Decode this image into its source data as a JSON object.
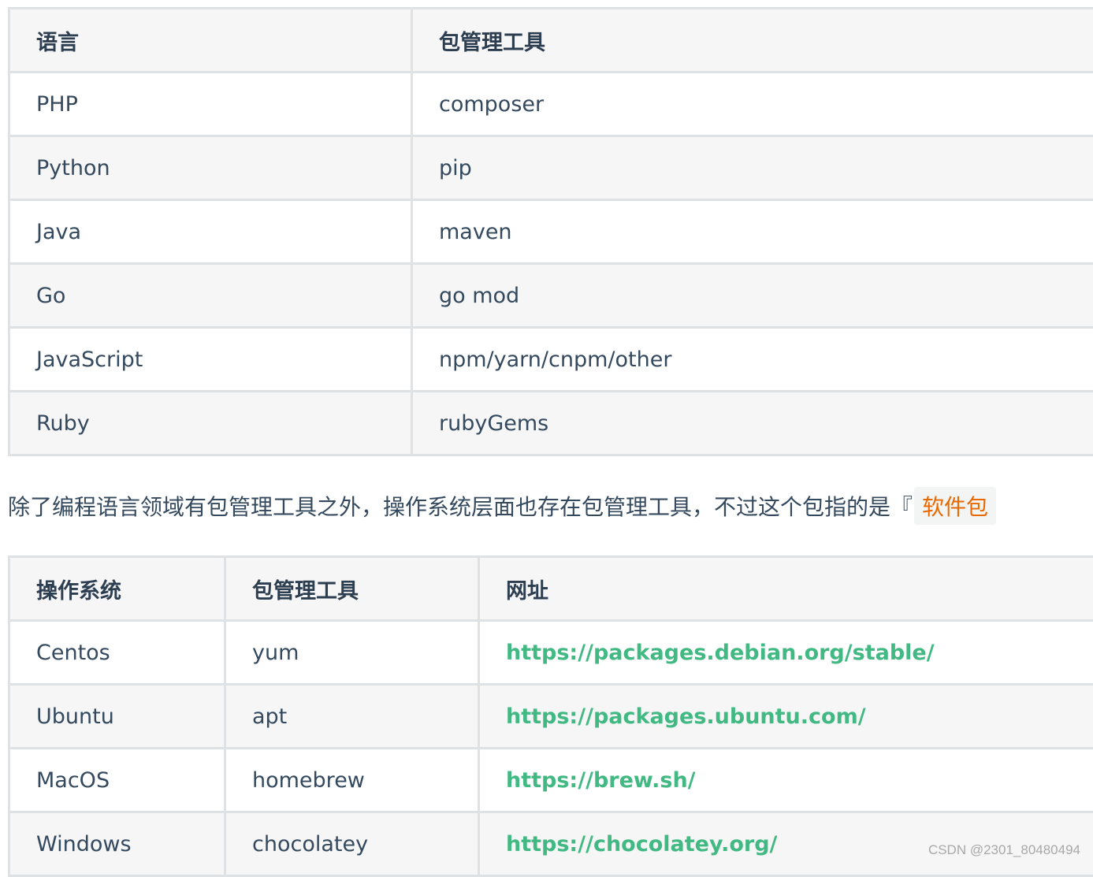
{
  "lang_table": {
    "headers": [
      "语言",
      "包管理工具"
    ],
    "rows": [
      [
        "PHP",
        "composer"
      ],
      [
        "Python",
        "pip"
      ],
      [
        "Java",
        "maven"
      ],
      [
        "Go",
        "go mod"
      ],
      [
        "JavaScript",
        "npm/yarn/cnpm/other"
      ],
      [
        "Ruby",
        "rubyGems"
      ]
    ]
  },
  "paragraph": {
    "text": "除了编程语言领域有包管理工具之外，操作系统层面也存在包管理工具，不过这个包指的是『",
    "code": "软件包"
  },
  "os_table": {
    "headers": [
      "操作系统",
      "包管理工具",
      "网址"
    ],
    "rows": [
      [
        "Centos",
        "yum",
        "https://packages.debian.org/stable/"
      ],
      [
        "Ubuntu",
        "apt",
        "https://packages.ubuntu.com/"
      ],
      [
        "MacOS",
        "homebrew",
        "https://brew.sh/"
      ],
      [
        "Windows",
        "chocolatey",
        "https://chocolatey.org/"
      ]
    ]
  },
  "watermark": "CSDN @2301_80480494",
  "colors": {
    "link": "#42b983",
    "code": "#e96900",
    "border": "#dfe2e5"
  }
}
